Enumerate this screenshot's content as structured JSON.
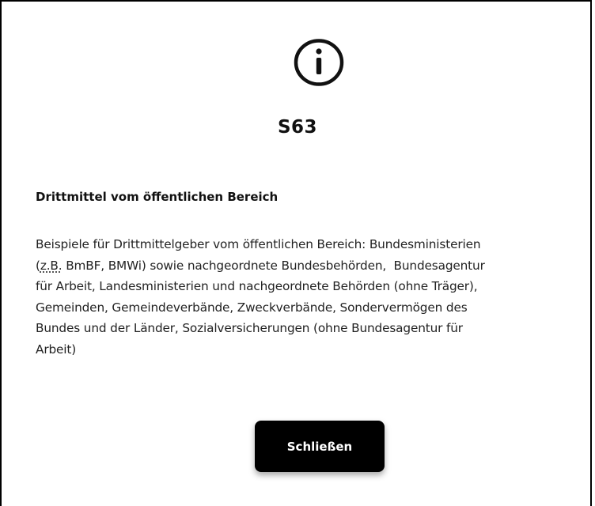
{
  "dialog": {
    "icon": "info-circle-icon",
    "title": "S63",
    "heading": "Drittmittel vom öffentlichen Bereich",
    "body": {
      "line1": "Beispiele für Drittmittelgeber vom öffentlichen Bereich: Bundesministerien",
      "line2_prefix": "(",
      "line2_abbr": "z.B.",
      "line2_rest": " BmBF, BMWi) sowie nachgeordnete Bundesbehörden,  Bundesagentur",
      "line3": "für Arbeit, Landesministerien und nachgeordnete Behörden (ohne Träger),",
      "line4": "Gemeinden, Gemeindeverbände, Zweckverbände, Sondervermögen des",
      "line5": "Bundes und der Länder, Sozialversicherungen (ohne Bundesagentur für",
      "line6": "Arbeit)"
    },
    "close_label": "Schließen"
  },
  "colors": {
    "button_bg": "#000000",
    "button_text": "#ffffff",
    "border": "#000000"
  }
}
